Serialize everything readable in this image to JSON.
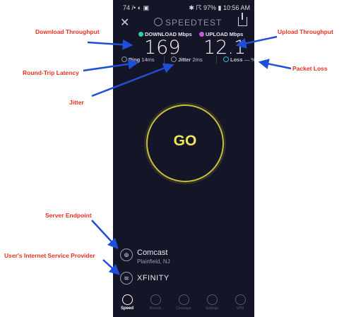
{
  "status_bar": {
    "left": "74 /• ◐ ▣",
    "right": "✱ ☈ 97% ▮ 10:56 AM"
  },
  "header": {
    "title": "SPEEDTEST"
  },
  "download": {
    "label": "DOWNLOAD Mbps",
    "value": "169"
  },
  "upload": {
    "label": "UPLOAD Mbps",
    "value": "12.1"
  },
  "ping": {
    "label": "Ping",
    "value": "14ms"
  },
  "jitter": {
    "label": "Jitter",
    "value": "2ms"
  },
  "loss": {
    "label": "Loss",
    "value": "— %"
  },
  "go_button": {
    "label": "GO"
  },
  "server": {
    "name": "Comcast",
    "location": "Plainfield, NJ"
  },
  "isp": {
    "name": "XFINITY"
  },
  "tabs": [
    {
      "label": "Speed",
      "active": true
    },
    {
      "label": "Results",
      "active": false
    },
    {
      "label": "Coverage",
      "active": false
    },
    {
      "label": "Settings",
      "active": false
    },
    {
      "label": "VPN",
      "active": false
    }
  ],
  "annotations": {
    "download": "Download Throughput",
    "upload": "Upload Throughput",
    "latency": "Round-Trip Latency",
    "packet_loss": "Packet Loss",
    "jitter": "Jitter",
    "server": "Server Endpoint",
    "isp": "User's Internet Service Provider"
  },
  "colors": {
    "download": "#2ed0a0",
    "upload": "#c35cdc",
    "accent": "#f1e55a",
    "annotation": "#e8321f",
    "arrow": "#1f4fd8"
  }
}
